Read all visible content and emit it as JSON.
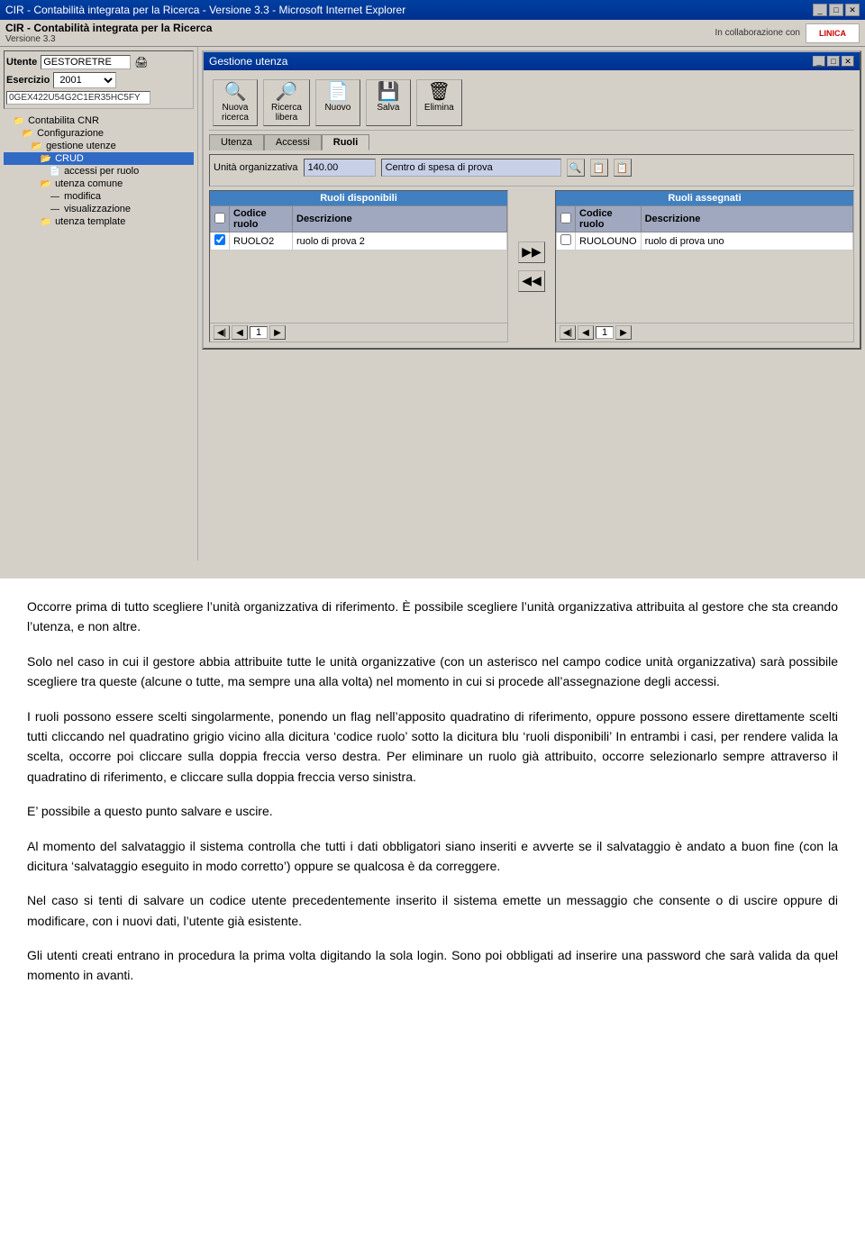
{
  "window": {
    "title": "CIR - Contabilità integrata per la Ricerca - Versione 3.3 - Microsoft Internet Explorer",
    "title_short": "CIR - Contabilità integrata per la Ricerca",
    "version": "Versione 3.3",
    "min_btn": "_",
    "max_btn": "□",
    "close_btn": "✕"
  },
  "app_header": {
    "title": "CIR - Contabilità integrata per la Ricerca",
    "version": "Versione 3.3",
    "logo": "LINICA",
    "collab": "In collaborazione con"
  },
  "menu": {
    "items": []
  },
  "sidebar": {
    "user_label": "Utente",
    "user_value": "GESTORETRE",
    "user_icon": "🖨",
    "esercizio_label": "Esercizio",
    "esercizio_value": "2001",
    "session_id": "0GEX422U54G2C1ER35HC5FY",
    "tree": [
      {
        "label": "Contabilita CNR",
        "indent": 1,
        "icon": "📁",
        "expanded": true
      },
      {
        "label": "Configurazione",
        "indent": 2,
        "icon": "📂",
        "expanded": true
      },
      {
        "label": "gestione utenze",
        "indent": 3,
        "icon": "📂",
        "expanded": true
      },
      {
        "label": "CRUD",
        "indent": 4,
        "icon": "📂",
        "expanded": true,
        "selected": true
      },
      {
        "label": "accessi per ruolo",
        "indent": 5,
        "icon": "📄"
      },
      {
        "label": "utenza comune",
        "indent": 4,
        "icon": "📂",
        "expanded": true
      },
      {
        "label": "modifica",
        "indent": 5,
        "icon": "📄"
      },
      {
        "label": "visualizzazione",
        "indent": 5,
        "icon": "📄"
      },
      {
        "label": "utenza template",
        "indent": 4,
        "icon": "📂",
        "expanded": false
      }
    ]
  },
  "dialog": {
    "title": "Gestione utenza",
    "min_btn": "_",
    "max_btn": "□",
    "close_btn": "✕",
    "toolbar": {
      "buttons": [
        {
          "id": "nuova-ricerca",
          "icon": "🔍",
          "label": "Nuova\nricerca"
        },
        {
          "id": "ricerca-libera",
          "icon": "🔍",
          "label": "Ricerca\nlibera"
        },
        {
          "id": "nuovo",
          "icon": "📄",
          "label": "Nuovo"
        },
        {
          "id": "salva",
          "icon": "💾",
          "label": "Salva"
        },
        {
          "id": "elimina",
          "icon": "🗑",
          "label": "Elimina"
        }
      ]
    },
    "tabs": [
      "Utenza",
      "Accessi",
      "Ruoli"
    ],
    "active_tab": "Ruoli",
    "form": {
      "unita_label": "Unità organizzativa",
      "unita_value": "140.00",
      "centro_value": "Centro di spesa di prova",
      "search_btn": "🔍",
      "browse_btn": "📋"
    },
    "available_roles": {
      "panel_title": "Ruoli disponibili",
      "columns": [
        "✓",
        "Codice ruolo",
        "Descrizione"
      ],
      "rows": [
        {
          "checked": true,
          "code": "RUOLO2",
          "desc": "ruolo di prova 2"
        }
      ],
      "pagination": {
        "first": "◀◀",
        "prev": "◀",
        "page": "1",
        "next": "▶"
      }
    },
    "assigned_roles": {
      "panel_title": "Ruoli assegnati",
      "columns": [
        "✓",
        "Codice ruolo",
        "Descrizione"
      ],
      "rows": [
        {
          "checked": false,
          "code": "RUOLOUNO",
          "desc": "ruolo di prova uno"
        }
      ],
      "pagination": {
        "first": "◀◀",
        "prev": "◀",
        "page": "1",
        "next": "▶"
      }
    },
    "arrows": {
      "right": "▶▶",
      "left": "◀◀"
    }
  },
  "text_sections": [
    {
      "id": "p1",
      "text": "Occorre prima di tutto scegliere l’unità organizzativa di riferimento. È possibile scegliere l’unità organizzativa attribuita al gestore che sta creando l’utenza, e non altre."
    },
    {
      "id": "p2",
      "text": "Solo nel caso in cui il gestore abbia attribuite tutte le unità organizzative (con un asterisco nel campo codice unità organizzativa) sarà possibile scegliere tra queste (alcune o tutte, ma sempre una alla volta) nel momento in cui si procede all’assegnazione degli accessi."
    },
    {
      "id": "p3",
      "text": "I ruoli possono essere scelti singolarmente, ponendo un flag nell’apposito quadratino di riferimento, oppure possono essere direttamente scelti tutti cliccando nel quadratino grigio vicino alla dicitura ‘codice ruolo’ sotto la dicitura blu ‘ruoli disponibili’ In entrambi i casi, per rendere valida la scelta, occorre poi cliccare sulla doppia freccia verso destra. Per eliminare un ruolo già attribuito, occorre selezionarlo sempre attraverso il quadratino di riferimento, e cliccare sulla doppia freccia verso sinistra."
    },
    {
      "id": "p4",
      "text": "E’ possibile a questo punto salvare e uscire."
    },
    {
      "id": "p5",
      "text": "Al momento del salvataggio il sistema controlla che tutti i dati obbligatori siano inseriti e avverte se il salvataggio è andato a buon fine (con la dicitura ‘salvataggio eseguito in modo corretto’) oppure se qualcosa è da correggere."
    },
    {
      "id": "p6",
      "text": "Nel caso si tenti di salvare un codice utente precedentemente inserito il sistema emette un messaggio che consente o di uscire oppure di modificare, con i nuovi dati, l’utente già esistente."
    },
    {
      "id": "p7",
      "text": "Gli utenti creati entrano in procedura la prima volta digitando la sola login. Sono poi obbligati ad inserire una password che sarà valida da quel momento in avanti."
    }
  ]
}
